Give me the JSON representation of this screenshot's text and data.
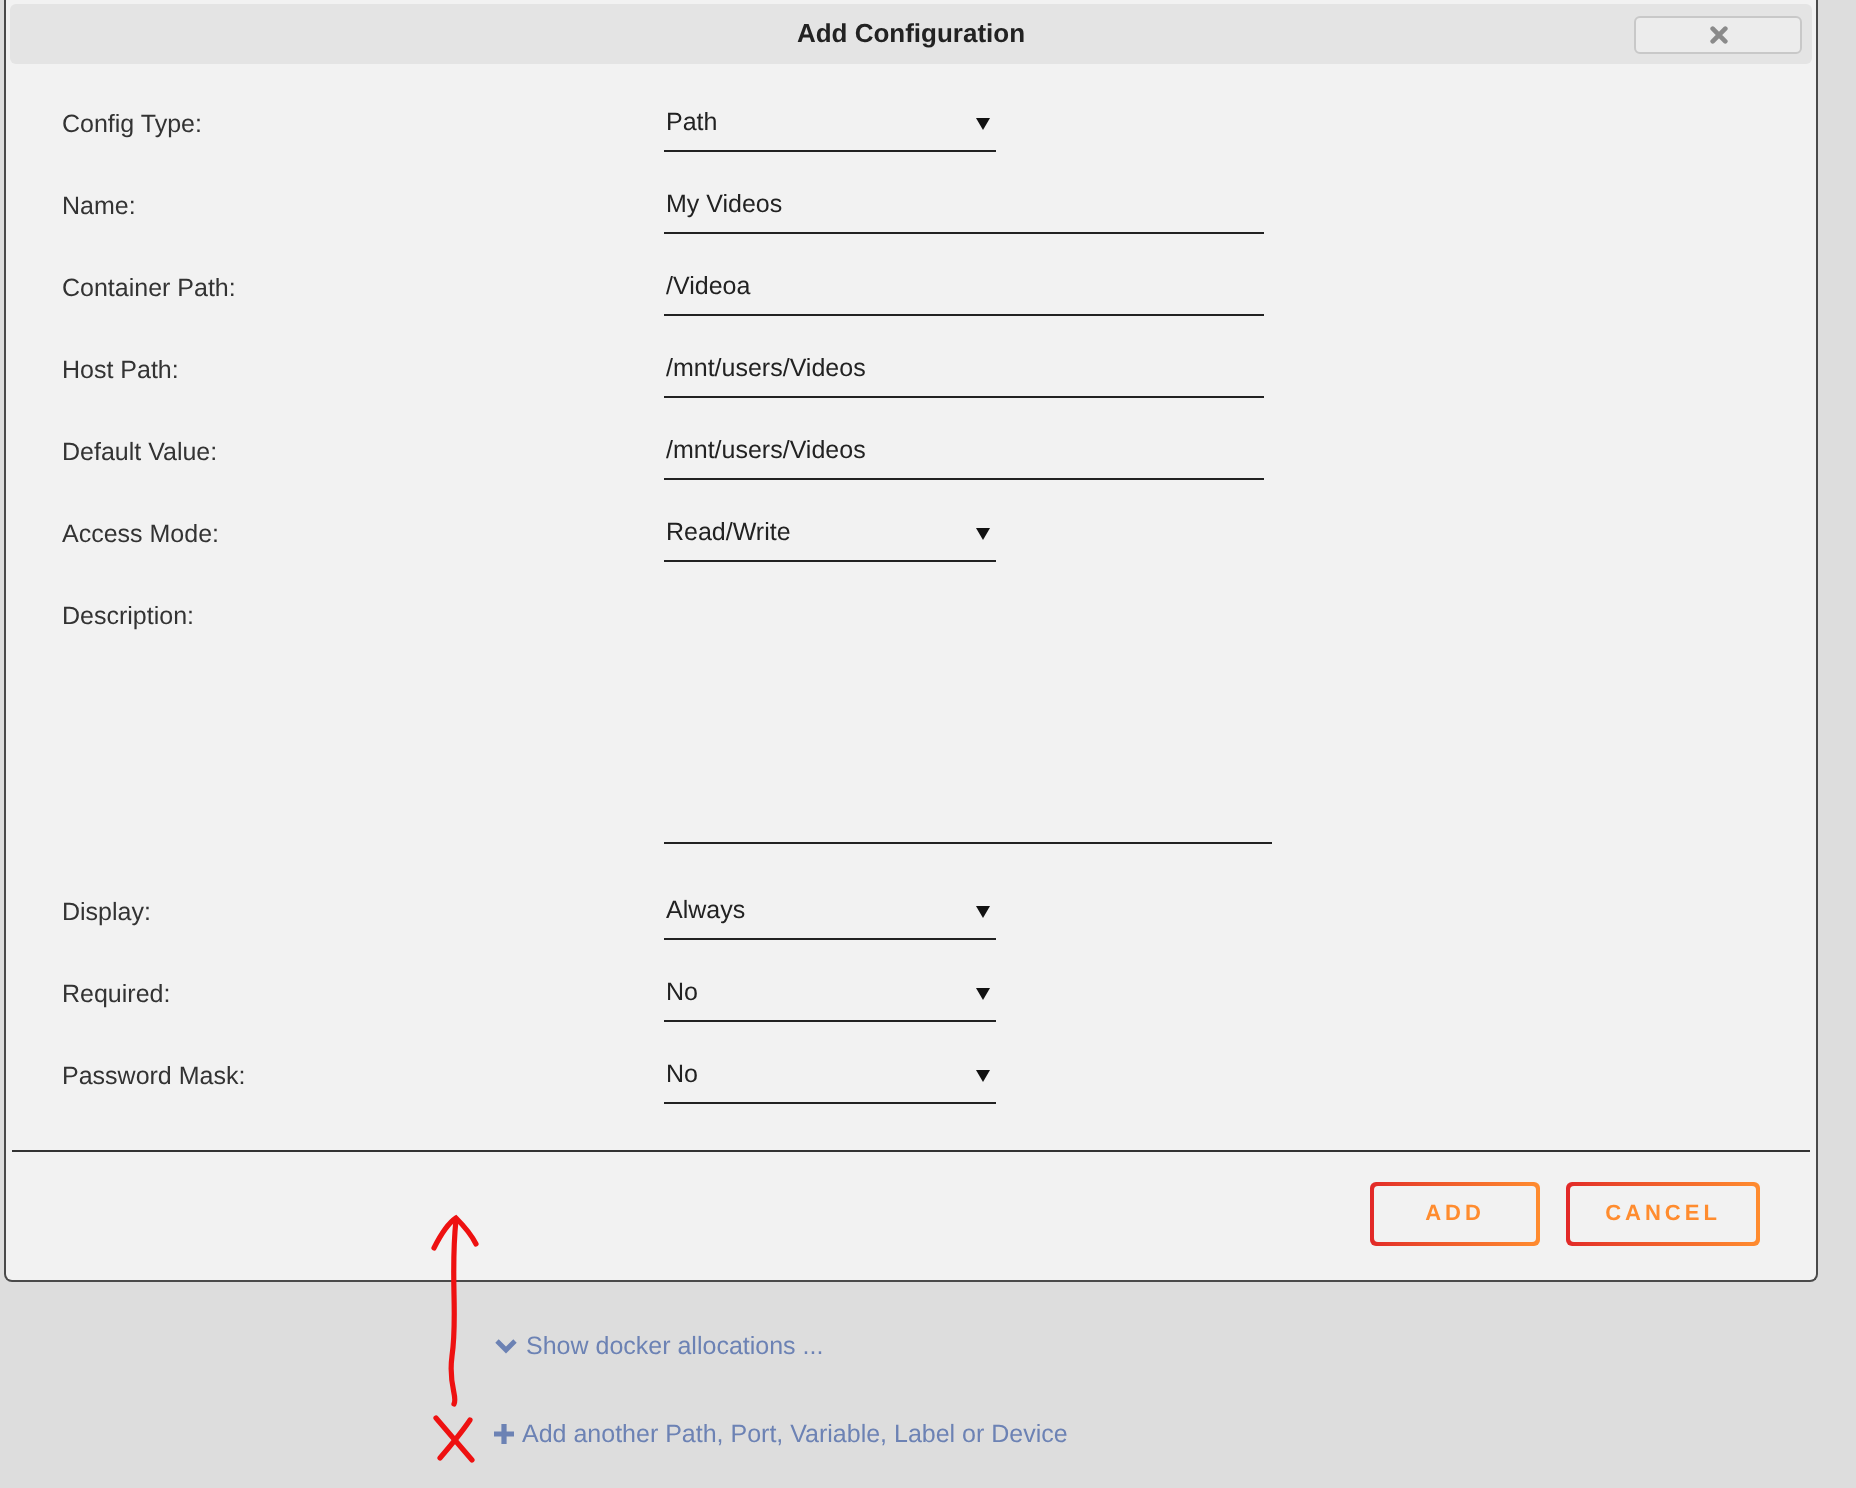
{
  "dialog": {
    "title": "Add Configuration",
    "fields": [
      {
        "label": "Config Type:",
        "kind": "select",
        "value": "Path"
      },
      {
        "label": "Name:",
        "kind": "text",
        "value": "My Videos"
      },
      {
        "label": "Container Path:",
        "kind": "text",
        "value": "/Videoa"
      },
      {
        "label": "Host Path:",
        "kind": "text",
        "value": "/mnt/users/Videos"
      },
      {
        "label": "Default Value:",
        "kind": "text",
        "value": "/mnt/users/Videos"
      },
      {
        "label": "Access Mode:",
        "kind": "select",
        "value": "Read/Write"
      },
      {
        "label": "Description:",
        "kind": "textarea"
      },
      {
        "label": "Display:",
        "kind": "select",
        "value": "Always"
      },
      {
        "label": "Required:",
        "kind": "select",
        "value": "No"
      },
      {
        "label": "Password Mask:",
        "kind": "select",
        "value": "No"
      }
    ],
    "buttons": [
      {
        "label": "ADD"
      },
      {
        "label": "CANCEL"
      }
    ]
  },
  "links": [
    {
      "kind": "expand",
      "label": "Show docker allocations ..."
    },
    {
      "kind": "add",
      "label": "Add another Path, Port, Variable, Label or Device"
    }
  ]
}
